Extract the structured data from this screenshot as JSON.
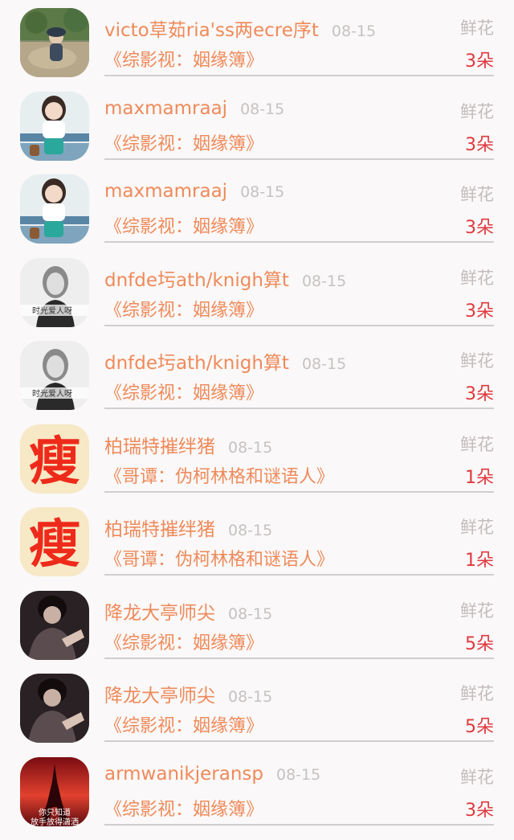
{
  "colors": {
    "name": "#ef8a5a",
    "date": "#c7c2c2",
    "count": "#e0393e",
    "divider": "#cfcfcf",
    "background": "#faf8f8"
  },
  "rows": [
    {
      "avatar": "landscape-photo-avatar",
      "name": "victo草茹ria'ss两ecre序t",
      "date": "08-15",
      "type": "鲜花",
      "book": "《综影视：姻缘簿》",
      "count": "3朵"
    },
    {
      "avatar": "girl-bench-avatar",
      "name": "maxmamraaj",
      "date": "08-15",
      "type": "鲜花",
      "book": "《综影视：姻缘簿》",
      "count": "3朵"
    },
    {
      "avatar": "girl-bench-avatar",
      "name": "maxmamraaj",
      "date": "08-15",
      "type": "鲜花",
      "book": "《综影视：姻缘簿》",
      "count": "3朵"
    },
    {
      "avatar": "bw-portrait-avatar",
      "name": "dnfde圬ath/knigh算t",
      "date": "08-15",
      "type": "鲜花",
      "book": "《综影视：姻缘簿》",
      "count": "3朵"
    },
    {
      "avatar": "bw-portrait-avatar",
      "name": "dnfde圬ath/knigh算t",
      "date": "08-15",
      "type": "鲜花",
      "book": "《综影视：姻缘簿》",
      "count": "3朵"
    },
    {
      "avatar": "shou-character-avatar",
      "name": "柏瑞特摧绊猪",
      "date": "08-15",
      "type": "鲜花",
      "book": "《哥谭：伪柯林格和谜语人》",
      "count": "1朵"
    },
    {
      "avatar": "shou-character-avatar",
      "name": "柏瑞特摧绊猪",
      "date": "08-15",
      "type": "鲜花",
      "book": "《哥谭：伪柯林格和谜语人》",
      "count": "1朵"
    },
    {
      "avatar": "dark-portrait-avatar",
      "name": "降龙大亭师尖",
      "date": "08-15",
      "type": "鲜花",
      "book": "《综影视：姻缘簿》",
      "count": "5朵"
    },
    {
      "avatar": "dark-portrait-avatar",
      "name": "降龙大亭师尖",
      "date": "08-15",
      "type": "鲜花",
      "book": "《综影视：姻缘簿》",
      "count": "5朵"
    },
    {
      "avatar": "eiffel-sunset-avatar",
      "name": "armwanikjeransp",
      "date": "08-15",
      "type": "鲜花",
      "book": "《综影视：姻缘簿》",
      "count": "3朵",
      "avatar_caption_1": "你只知道",
      "avatar_caption_2": "放手放得潇洒"
    }
  ],
  "shou_glyph": "瘦",
  "bw_caption": "时光爱人呀"
}
